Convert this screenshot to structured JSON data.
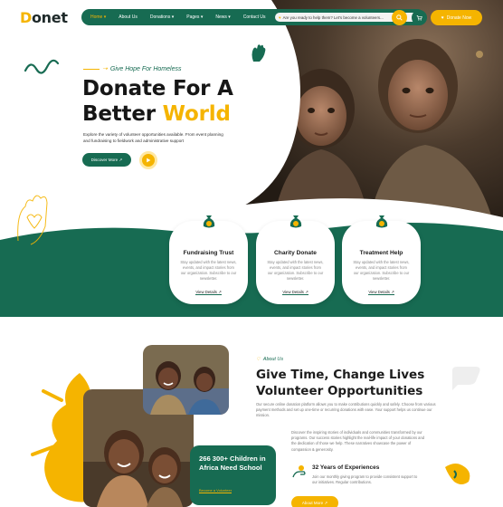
{
  "brand": {
    "logo_text": "Donet",
    "logo_first_letter": "D",
    "logo_rest": "onet"
  },
  "nav": {
    "items": [
      {
        "label": "Home ▾"
      },
      {
        "label": "About Us"
      },
      {
        "label": "Donations ▾"
      },
      {
        "label": "Pages ▾"
      },
      {
        "label": "News ▾"
      },
      {
        "label": "Contact Us"
      }
    ],
    "message": "Are you ready to help them? Let's become a volunteers...",
    "donate_label": "Donate Now"
  },
  "hero": {
    "tagline": "Give Hope For Homeless",
    "title_line1": "Donate For A",
    "title_line2_plain": "Better ",
    "title_line2_highlight": "World",
    "description": "Explore the variety of volunteer opportunities available. From event planning and fundraising to fieldwork and administrative support",
    "cta_label": "Discover More ↗"
  },
  "cards": [
    {
      "title": "Fundraising Trust",
      "text": "Stay updated with the latest news, events, and impact stories from our organization. Subscribe to our newsletter.",
      "link": "View Details ↗",
      "icon": "money-bag-icon"
    },
    {
      "title": "Charity Donate",
      "text": "Stay updated with the latest news, events, and impact stories from our organization. Subscribe to our newsletter.",
      "link": "View Details ↗",
      "icon": "money-bag-icon"
    },
    {
      "title": "Treatment Help",
      "text": "Stay updated with the latest news, events, and impact stories from our organization. Subscribe to our newsletter.",
      "link": "View Details ↗",
      "icon": "money-bag-icon"
    }
  ],
  "about": {
    "label": "About Us",
    "title_line1": "Give Time, Change Lives",
    "title_line2": "Volunteer Opportunities",
    "description": "Our secure online donation platform allows you to make contributions quickly and safely. Choose from various payment methods and set up one-time or recurring donations with ease. Your support helps us continue our mission.",
    "sub_description": "Discover the inspiring stories of individuals and communities transformed by our programs. Our success stories highlight the real-life impact of your donations and the dedication of those we help. These narratives showcase the power of compassion & generosity.",
    "experience_title": "32 Years of Experiences",
    "experience_text": "Join our monthly giving program to provide consistent support to our initiatives. Regular contributions.",
    "cta_label": "About More ↗",
    "children_card_title": "266 300+ Children in Africa Need School",
    "children_card_link": "Become a Volunteer"
  },
  "colors": {
    "primary_green": "#176b52",
    "accent_yellow": "#f5b400",
    "dark_text": "#161616"
  }
}
